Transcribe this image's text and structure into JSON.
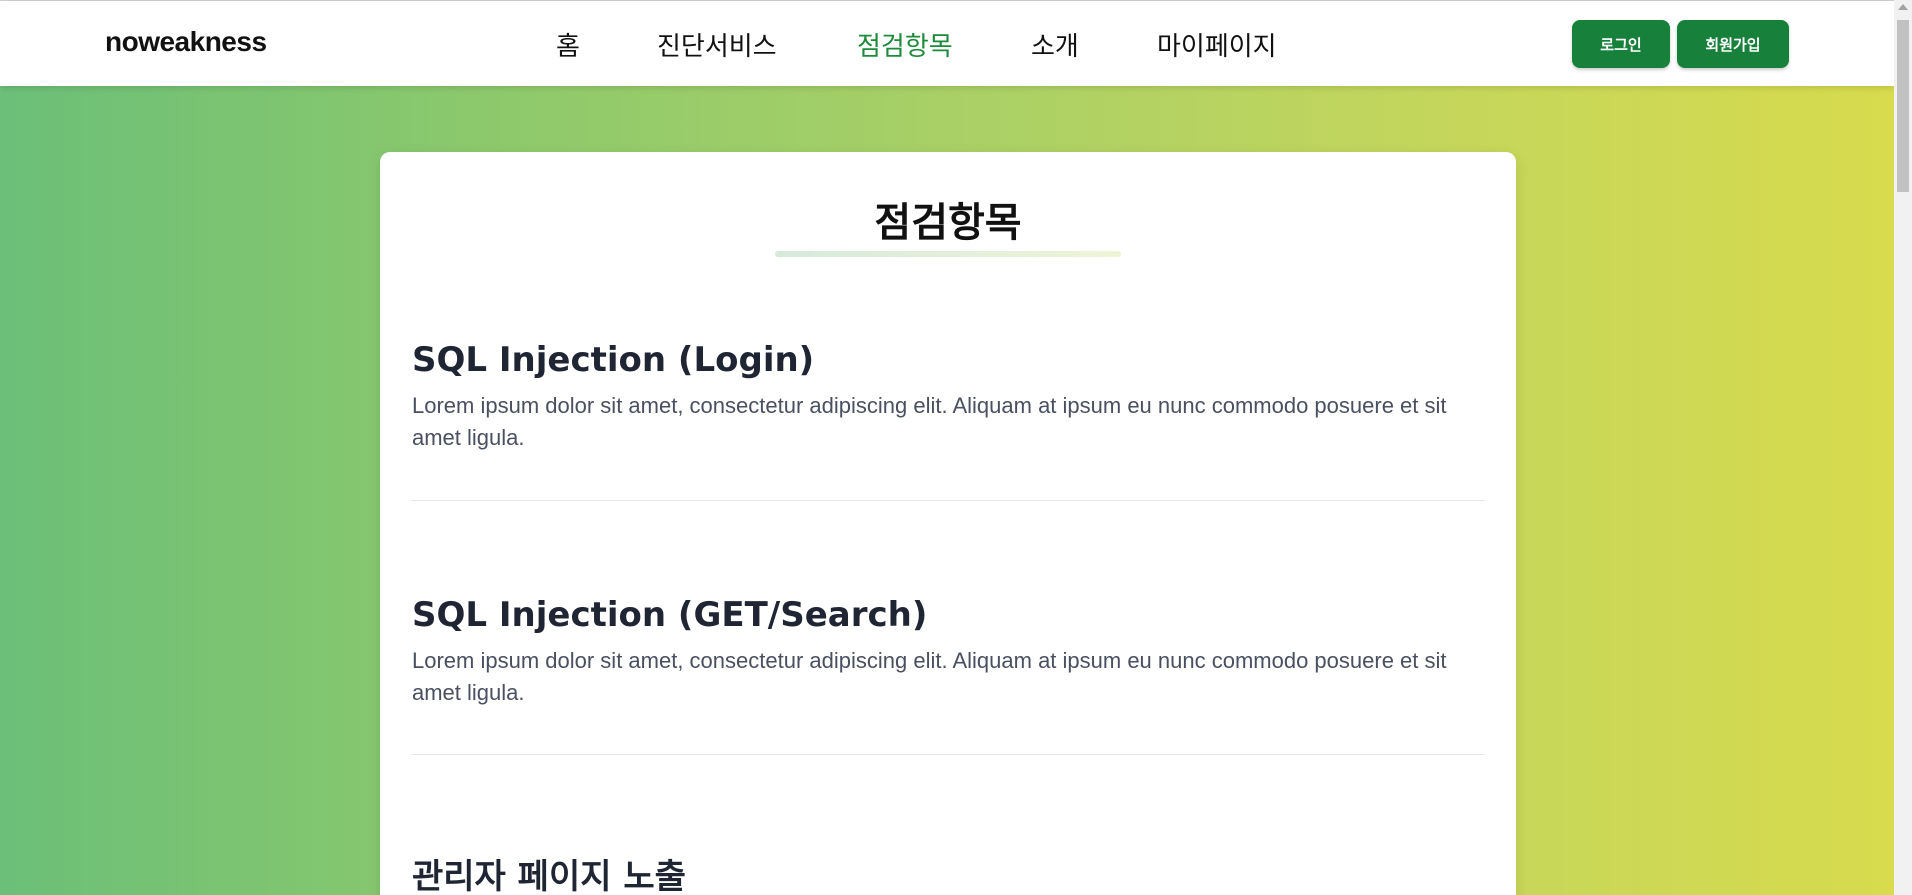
{
  "header": {
    "logo": "noweakness",
    "nav": [
      {
        "label": "홈",
        "active": false
      },
      {
        "label": "진단서비스",
        "active": false
      },
      {
        "label": "점검항목",
        "active": true
      },
      {
        "label": "소개",
        "active": false
      },
      {
        "label": "마이페이지",
        "active": false
      }
    ],
    "login_label": "로그인",
    "signup_label": "회원가입"
  },
  "main": {
    "title": "점검항목",
    "items": [
      {
        "title": "SQL Injection (Login)",
        "description": "Lorem ipsum dolor sit amet, consectetur adipiscing elit. Aliquam at ipsum eu nunc commodo posuere et sit amet ligula."
      },
      {
        "title": "SQL Injection (GET/Search)",
        "description": "Lorem ipsum dolor sit amet, consectetur adipiscing elit. Aliquam at ipsum eu nunc commodo posuere et sit amet ligula."
      },
      {
        "title": "관리자 페이지 노출",
        "description": ""
      }
    ]
  },
  "colors": {
    "accent": "#17803a",
    "active_nav": "#1e8a3c",
    "gradient_start": "#6bbf78",
    "gradient_end": "#d8db4c"
  }
}
